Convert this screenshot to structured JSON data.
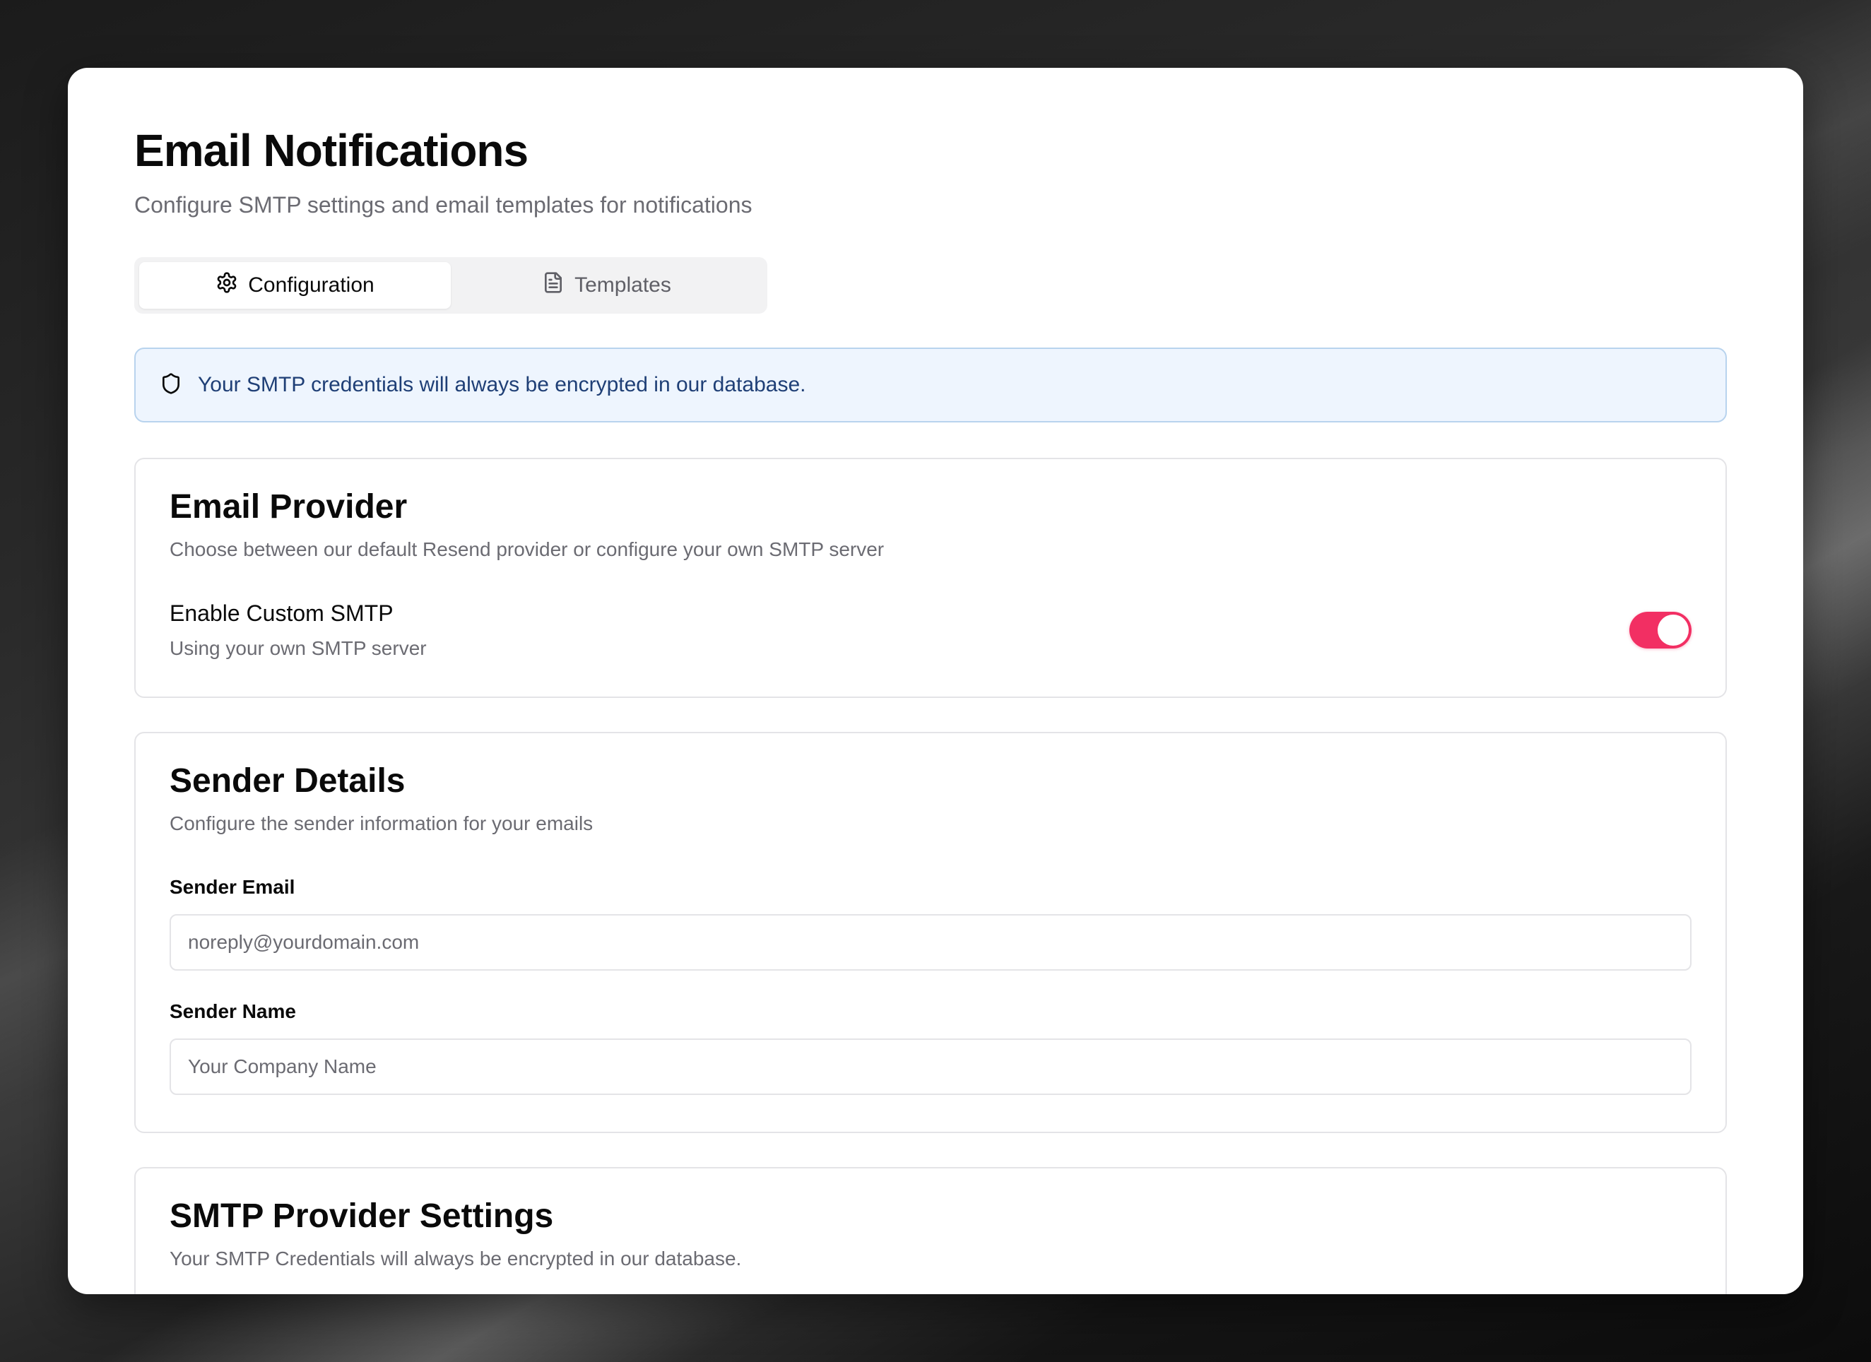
{
  "header": {
    "title": "Email Notifications",
    "subtitle": "Configure SMTP settings and email templates for notifications"
  },
  "tabs": [
    {
      "label": "Configuration",
      "icon": "gear-icon",
      "active": true
    },
    {
      "label": "Templates",
      "icon": "file-text-icon",
      "active": false
    }
  ],
  "alert": {
    "icon": "shield-icon",
    "text": "Your SMTP credentials will always be encrypted in our database."
  },
  "email_provider": {
    "title": "Email Provider",
    "description": "Choose between our default Resend provider or configure your own SMTP server",
    "custom_smtp_label": "Enable Custom SMTP",
    "custom_smtp_status": "Using your own SMTP server",
    "custom_smtp_enabled": true
  },
  "sender_details": {
    "title": "Sender Details",
    "description": "Configure the sender information for your emails",
    "email_label": "Sender Email",
    "email_value": "",
    "email_placeholder": "noreply@yourdomain.com",
    "name_label": "Sender Name",
    "name_value": "",
    "name_placeholder": "Your Company Name"
  },
  "smtp_settings": {
    "title": "SMTP Provider Settings",
    "description": "Your SMTP Credentials will always be encrypted in our database."
  },
  "colors": {
    "accent": "#f22f63",
    "alert_bg": "#eef5fe",
    "alert_border": "#b8d3ee",
    "alert_text": "#1f3f76"
  }
}
